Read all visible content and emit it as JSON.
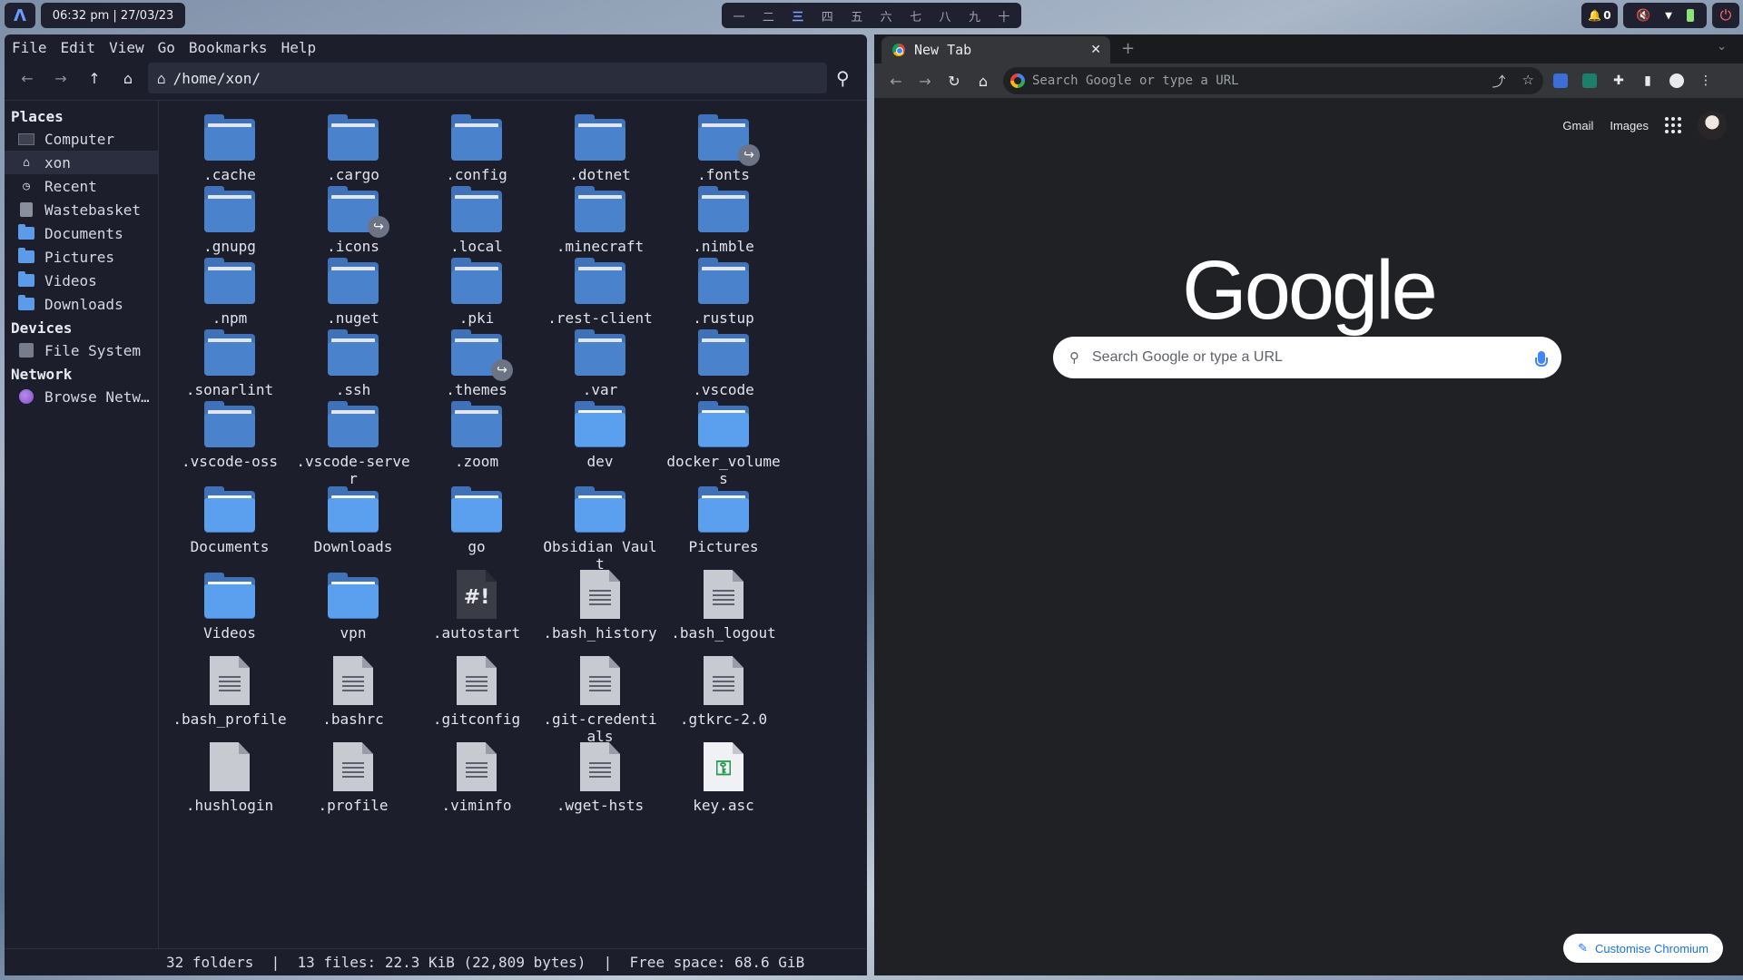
{
  "topbar": {
    "launcher_glyph": "Λ",
    "clock": "06:32 pm | 27/03/23",
    "workspaces": [
      "一",
      "二",
      "三",
      "四",
      "五",
      "六",
      "七",
      "八",
      "九",
      "十"
    ],
    "active_workspace_index": 2,
    "notifications": "0"
  },
  "filemanager": {
    "menu": [
      "File",
      "Edit",
      "View",
      "Go",
      "Bookmarks",
      "Help"
    ],
    "path": "/home/xon/",
    "sidebar": {
      "places_header": "Places",
      "places": [
        {
          "label": "Computer",
          "icon": "computer-icon"
        },
        {
          "label": "xon",
          "icon": "home-icon"
        },
        {
          "label": "Recent",
          "icon": "recent-icon"
        },
        {
          "label": "Wastebasket",
          "icon": "trash-icon"
        },
        {
          "label": "Documents",
          "icon": "folder-icon"
        },
        {
          "label": "Pictures",
          "icon": "folder-icon"
        },
        {
          "label": "Videos",
          "icon": "folder-icon"
        },
        {
          "label": "Downloads",
          "icon": "folder-icon"
        }
      ],
      "devices_header": "Devices",
      "devices": [
        {
          "label": "File System",
          "icon": "disk-icon"
        }
      ],
      "network_header": "Network",
      "network": [
        {
          "label": "Browse Netw…",
          "icon": "network-icon"
        }
      ]
    },
    "rows": [
      [
        {
          "name": ".cache",
          "type": "folder"
        },
        {
          "name": ".cargo",
          "type": "folder"
        },
        {
          "name": ".config",
          "type": "folder"
        },
        {
          "name": ".dotnet",
          "type": "folder"
        },
        {
          "name": ".fonts",
          "type": "link-folder"
        }
      ],
      [
        {
          "name": ".gnupg",
          "type": "folder"
        },
        {
          "name": ".icons",
          "type": "link-folder"
        },
        {
          "name": ".local",
          "type": "folder"
        },
        {
          "name": ".minecraft",
          "type": "folder"
        },
        {
          "name": ".nimble",
          "type": "folder"
        }
      ],
      [
        {
          "name": ".npm",
          "type": "folder"
        },
        {
          "name": ".nuget",
          "type": "folder"
        },
        {
          "name": ".pki",
          "type": "folder"
        },
        {
          "name": ".rest-client",
          "type": "folder"
        },
        {
          "name": ".rustup",
          "type": "folder"
        }
      ],
      [
        {
          "name": ".sonarlint",
          "type": "folder"
        },
        {
          "name": ".ssh",
          "type": "folder"
        },
        {
          "name": ".themes",
          "type": "link-folder"
        },
        {
          "name": ".var",
          "type": "folder"
        },
        {
          "name": ".vscode",
          "type": "folder"
        }
      ],
      [
        {
          "name": ".vscode-oss",
          "type": "folder"
        },
        {
          "name": ".vscode-server",
          "type": "folder"
        },
        {
          "name": ".zoom",
          "type": "folder"
        },
        {
          "name": "dev",
          "type": "plain-folder"
        },
        {
          "name": "docker_volumes",
          "type": "plain-folder"
        }
      ],
      [
        {
          "name": "Documents",
          "type": "plain-folder"
        },
        {
          "name": "Downloads",
          "type": "plain-folder"
        },
        {
          "name": "go",
          "type": "plain-folder"
        },
        {
          "name": "Obsidian Vault",
          "type": "plain-folder"
        },
        {
          "name": "Pictures",
          "type": "plain-folder"
        }
      ],
      [
        {
          "name": "Videos",
          "type": "plain-folder"
        },
        {
          "name": "vpn",
          "type": "plain-folder"
        },
        {
          "name": ".autostart",
          "type": "script"
        },
        {
          "name": ".bash_history",
          "type": "text"
        },
        {
          "name": ".bash_logout",
          "type": "text"
        }
      ],
      [
        {
          "name": ".bash_profile",
          "type": "text"
        },
        {
          "name": ".bashrc",
          "type": "text"
        },
        {
          "name": ".gitconfig",
          "type": "text"
        },
        {
          "name": ".git-credentials",
          "type": "text"
        },
        {
          "name": ".gtkrc-2.0",
          "type": "text"
        }
      ],
      [
        {
          "name": ".hushlogin",
          "type": "blank"
        },
        {
          "name": ".profile",
          "type": "text"
        },
        {
          "name": ".viminfo",
          "type": "text"
        },
        {
          "name": ".wget-hsts",
          "type": "text"
        },
        {
          "name": "key.asc",
          "type": "key"
        }
      ]
    ],
    "status": "32 folders  |  13 files: 22.3 KiB (22,809 bytes)  |  Free space: 68.6 GiB"
  },
  "browser": {
    "tab_title": "New Tab",
    "omnibox_placeholder": "Search Google or type a URL",
    "ntp_links": [
      "Gmail",
      "Images"
    ],
    "logo": "Google",
    "search_placeholder": "Search Google or type a URL",
    "customise_label": "Customise Chromium"
  }
}
